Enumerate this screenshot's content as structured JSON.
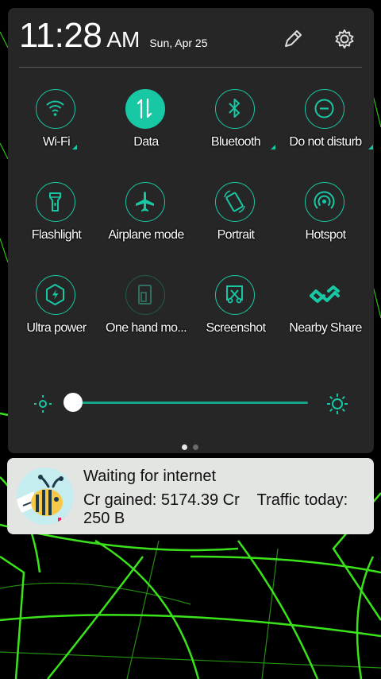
{
  "header": {
    "time": "11:28",
    "ampm": "AM",
    "date": "Sun, Apr 25"
  },
  "tiles": [
    {
      "label": "Wi-Fi",
      "icon": "wifi-icon"
    },
    {
      "label": "Data",
      "icon": "data-icon",
      "state": "on"
    },
    {
      "label": "Bluetooth",
      "icon": "bluetooth-icon"
    },
    {
      "label": "Do not disturb",
      "icon": "do-not-disturb-icon"
    },
    {
      "label": "Flashlight",
      "icon": "flashlight-icon"
    },
    {
      "label": "Airplane mode",
      "icon": "airplane-icon"
    },
    {
      "label": "Portrait",
      "icon": "rotation-lock-icon"
    },
    {
      "label": "Hotspot",
      "icon": "hotspot-icon"
    },
    {
      "label": "Ultra power",
      "icon": "ultra-power-icon"
    },
    {
      "label": "One hand mo...",
      "icon": "one-hand-mode-icon",
      "state": "disabled"
    },
    {
      "label": "Screenshot",
      "icon": "screenshot-icon"
    },
    {
      "label": "Nearby Share",
      "icon": "nearby-share-icon"
    }
  ],
  "brightness": {
    "level": 0.0
  },
  "pager": {
    "pages": 2,
    "current": 1
  },
  "notification": {
    "title": "Waiting for internet",
    "body": "Cr gained: 5174.39 Cr    Traffic today: 250 B",
    "icon": "honeygain-bee-icon"
  },
  "colors": {
    "accent": "#18c7a4",
    "panel": "#262626",
    "notification_bg": "#e3e5e2",
    "wallpaper_grid": "#3ef01c"
  }
}
